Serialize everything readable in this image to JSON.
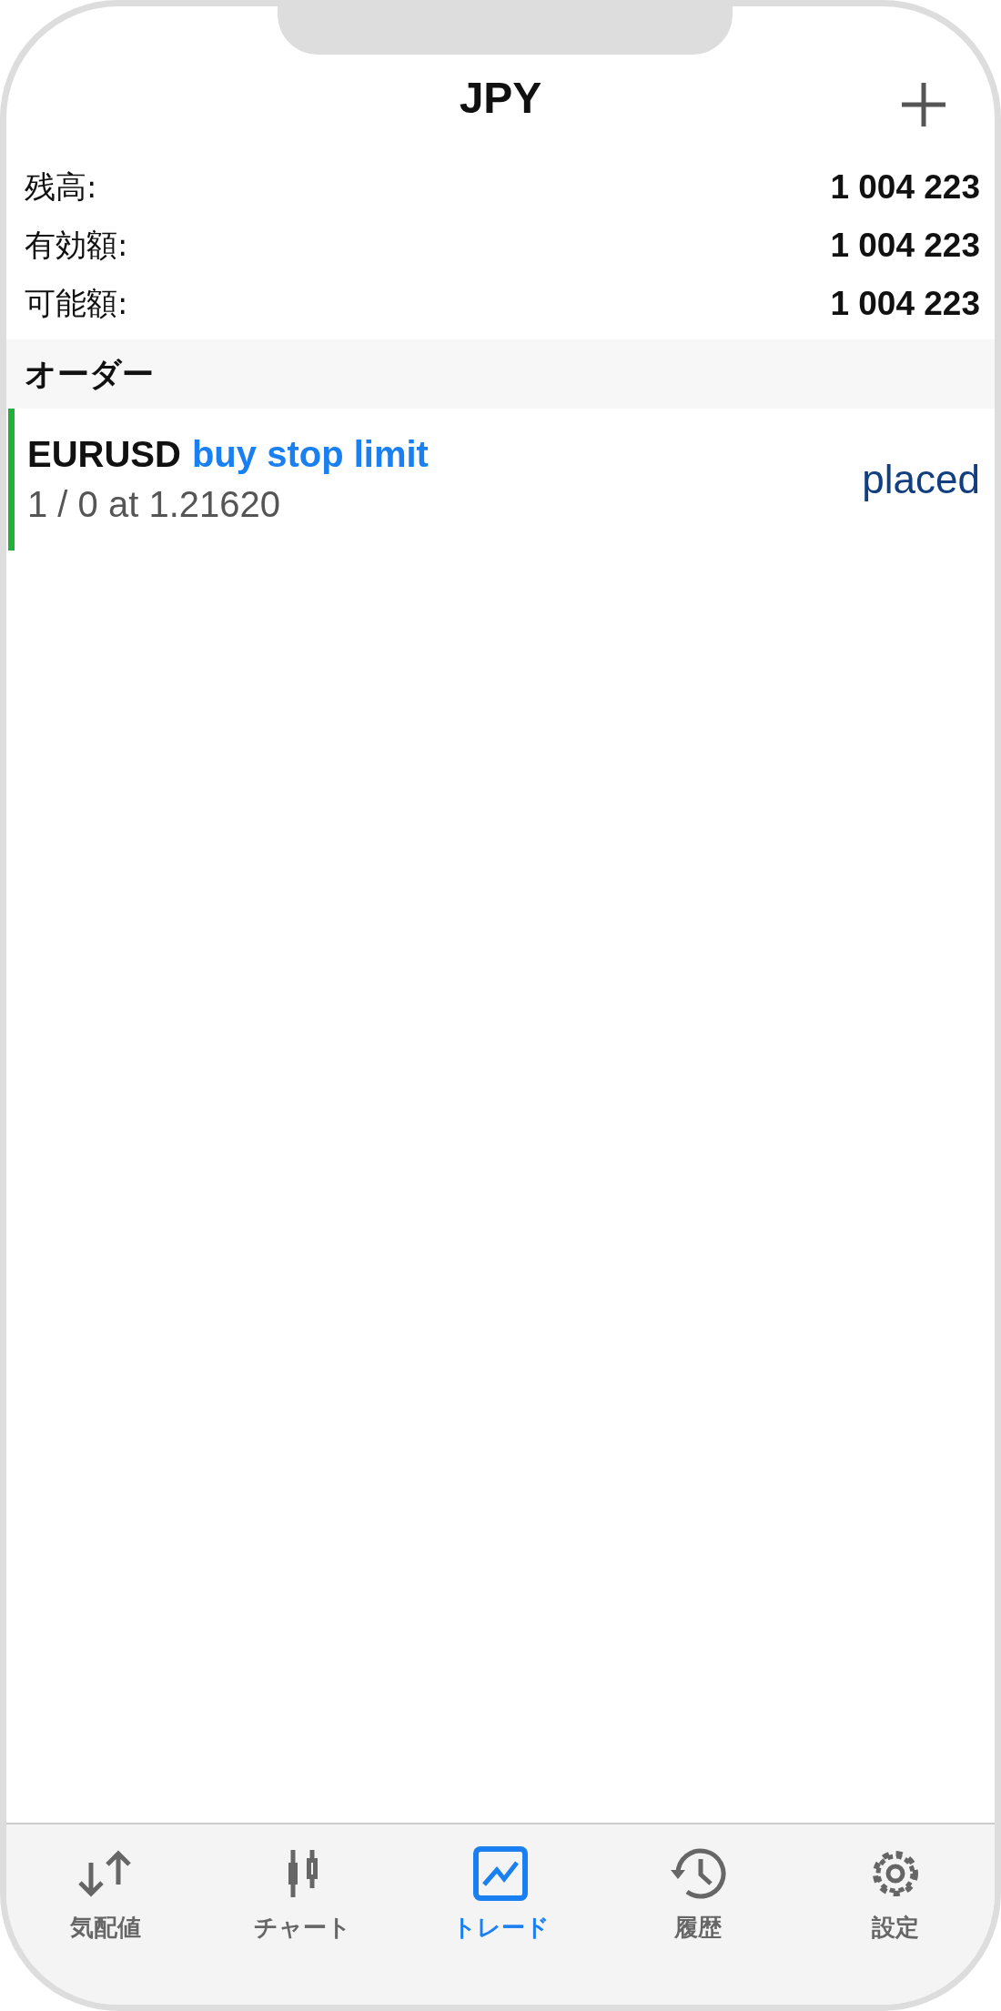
{
  "header": {
    "title": "JPY"
  },
  "account": [
    {
      "label": "残高:",
      "value": "1 004 223"
    },
    {
      "label": "有効額:",
      "value": "1 004 223"
    },
    {
      "label": "可能額:",
      "value": "1 004 223"
    }
  ],
  "section": {
    "title": "オーダー"
  },
  "orders": [
    {
      "symbol": "EURUSD",
      "type": "buy stop limit",
      "details": "1 / 0 at 1.21620",
      "status": "placed",
      "color": "#22b03a"
    }
  ],
  "tabs": [
    {
      "kind": "quotes",
      "label": "気配値",
      "selected": false
    },
    {
      "kind": "chart",
      "label": "チャート",
      "selected": false
    },
    {
      "kind": "trade",
      "label": "トレード",
      "selected": true
    },
    {
      "kind": "history",
      "label": "履歴",
      "selected": false
    },
    {
      "kind": "settings",
      "label": "設定",
      "selected": false
    }
  ]
}
